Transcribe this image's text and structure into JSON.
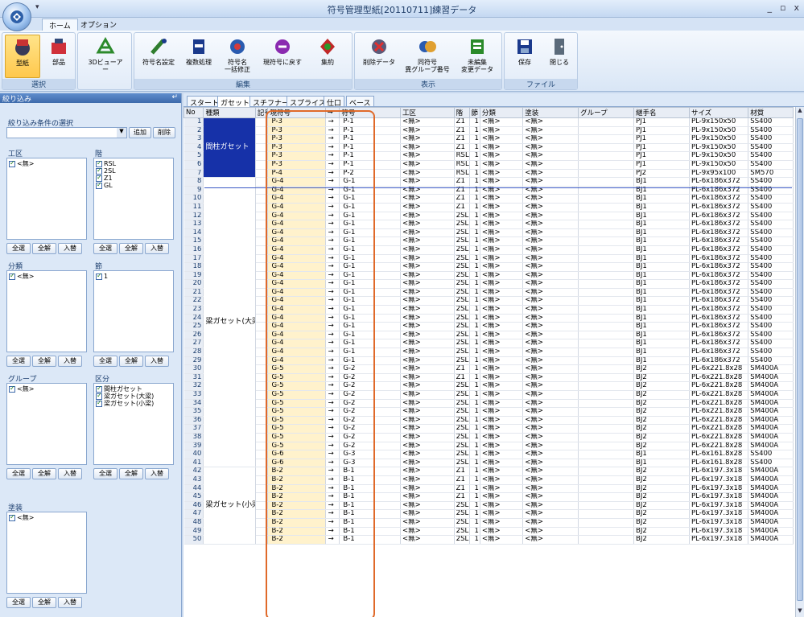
{
  "window": {
    "title": "符号管理型紙[20110711]練習データ",
    "quick_access": "▾",
    "controls": [
      "_",
      "▫",
      "x"
    ]
  },
  "ribbon_tabs": [
    "ホーム",
    "オプション"
  ],
  "ribbon": {
    "groups": [
      {
        "label": "選択",
        "buttons": [
          "型紙",
          "部品"
        ]
      },
      {
        "label": "",
        "buttons": [
          "3Dビューアー"
        ]
      },
      {
        "label": "編集",
        "buttons": [
          "符号名設定",
          "複数処理",
          "符号名\n一括修正",
          "現符号に戻す",
          "集約"
        ]
      },
      {
        "label": "表示",
        "buttons": [
          "削除データ",
          "同符号\n異グループ番号",
          "未編集\n変更データ"
        ]
      },
      {
        "label": "ファイル",
        "buttons": [
          "保存",
          "閉じる"
        ]
      }
    ]
  },
  "filter_panel": {
    "header": "絞り込み",
    "condition_label": "絞り込み条件の選択",
    "add_button": "追加",
    "delete_button": "削除",
    "sections": [
      {
        "title": "工区",
        "items": [
          "<無>"
        ]
      },
      {
        "title": "階",
        "items": [
          "RSL",
          "2SL",
          "Z1",
          "GL"
        ]
      },
      {
        "title": "分類",
        "items": [
          "<無>"
        ]
      },
      {
        "title": "節",
        "items": [
          "1"
        ]
      },
      {
        "title": "グループ",
        "items": [
          "<無>"
        ]
      },
      {
        "title": "区分",
        "items": [
          "間柱ガセット",
          "梁ガセット(大梁)",
          "梁ガセット(小梁)"
        ]
      },
      {
        "title": "塗装",
        "items": [
          "<無>"
        ]
      }
    ],
    "buttons": {
      "all_select": "全選",
      "all_clear": "全解",
      "swap": "入替"
    }
  },
  "grid_tabs": [
    "スタート",
    "ガセット",
    "スチフナー",
    "スプライス",
    "仕口",
    "ベース"
  ],
  "grid_active_tab": 1,
  "columns": [
    "No",
    "種類",
    "記号",
    "現符号",
    "→",
    "符号",
    "工区",
    "階",
    "節",
    "分類",
    "塗装",
    "グループ",
    "継手名",
    "サイズ",
    "材質"
  ],
  "groups": [
    {
      "label": "間柱ガセット",
      "start": 0,
      "span": 7,
      "highlight": true
    },
    {
      "label": "梁ガセット(大梁",
      "start": 7,
      "span": 34,
      "highlight": false
    },
    {
      "label": "梁ガセット(小梁",
      "start": 41,
      "span": 9,
      "highlight": false
    }
  ],
  "rows": [
    [
      "1",
      "P-3",
      "→",
      "P-1",
      "<無>",
      "Z1",
      "1",
      "<無>",
      "<無>",
      "",
      "PJ1",
      "PL-9x150x50",
      "SS400"
    ],
    [
      "2",
      "P-3",
      "→",
      "P-1",
      "<無>",
      "Z1",
      "1",
      "<無>",
      "<無>",
      "",
      "PJ1",
      "PL-9x150x50",
      "SS400"
    ],
    [
      "3",
      "P-3",
      "→",
      "P-1",
      "<無>",
      "Z1",
      "1",
      "<無>",
      "<無>",
      "",
      "PJ1",
      "PL-9x150x50",
      "SS400"
    ],
    [
      "4",
      "P-3",
      "→",
      "P-1",
      "<無>",
      "Z1",
      "1",
      "<無>",
      "<無>",
      "",
      "PJ1",
      "PL-9x150x50",
      "SS400"
    ],
    [
      "5",
      "P-3",
      "→",
      "P-1",
      "<無>",
      "RSL",
      "1",
      "<無>",
      "<無>",
      "",
      "PJ1",
      "PL-9x150x50",
      "SS400"
    ],
    [
      "6",
      "P-3",
      "→",
      "P-1",
      "<無>",
      "RSL",
      "1",
      "<無>",
      "<無>",
      "",
      "PJ1",
      "PL-9x150x50",
      "SS400"
    ],
    [
      "7",
      "P-4",
      "→",
      "P-2",
      "<無>",
      "RSL",
      "1",
      "<無>",
      "<無>",
      "",
      "PJ2",
      "PL-9x95x100",
      "SM570"
    ],
    [
      "8",
      "G-4",
      "→",
      "G-1",
      "<無>",
      "Z1",
      "1",
      "<無>",
      "<無>",
      "",
      "BJ1",
      "PL-6x186x372",
      "SS400"
    ],
    [
      "9",
      "G-4",
      "→",
      "G-1",
      "<無>",
      "Z1",
      "1",
      "<無>",
      "<無>",
      "",
      "BJ1",
      "PL-6x186x372",
      "SS400"
    ],
    [
      "10",
      "G-4",
      "→",
      "G-1",
      "<無>",
      "Z1",
      "1",
      "<無>",
      "<無>",
      "",
      "BJ1",
      "PL-6x186x372",
      "SS400"
    ],
    [
      "11",
      "G-4",
      "→",
      "G-1",
      "<無>",
      "Z1",
      "1",
      "<無>",
      "<無>",
      "",
      "BJ1",
      "PL-6x186x372",
      "SS400"
    ],
    [
      "12",
      "G-4",
      "→",
      "G-1",
      "<無>",
      "2SL",
      "1",
      "<無>",
      "<無>",
      "",
      "BJ1",
      "PL-6x186x372",
      "SS400"
    ],
    [
      "13",
      "G-4",
      "→",
      "G-1",
      "<無>",
      "2SL",
      "1",
      "<無>",
      "<無>",
      "",
      "BJ1",
      "PL-6x186x372",
      "SS400"
    ],
    [
      "14",
      "G-4",
      "→",
      "G-1",
      "<無>",
      "2SL",
      "1",
      "<無>",
      "<無>",
      "",
      "BJ1",
      "PL-6x186x372",
      "SS400"
    ],
    [
      "15",
      "G-4",
      "→",
      "G-1",
      "<無>",
      "2SL",
      "1",
      "<無>",
      "<無>",
      "",
      "BJ1",
      "PL-6x186x372",
      "SS400"
    ],
    [
      "16",
      "G-4",
      "→",
      "G-1",
      "<無>",
      "2SL",
      "1",
      "<無>",
      "<無>",
      "",
      "BJ1",
      "PL-6x186x372",
      "SS400"
    ],
    [
      "17",
      "G-4",
      "→",
      "G-1",
      "<無>",
      "2SL",
      "1",
      "<無>",
      "<無>",
      "",
      "BJ1",
      "PL-6x186x372",
      "SS400"
    ],
    [
      "18",
      "G-4",
      "→",
      "G-1",
      "<無>",
      "2SL",
      "1",
      "<無>",
      "<無>",
      "",
      "BJ1",
      "PL-6x186x372",
      "SS400"
    ],
    [
      "19",
      "G-4",
      "→",
      "G-1",
      "<無>",
      "2SL",
      "1",
      "<無>",
      "<無>",
      "",
      "BJ1",
      "PL-6x186x372",
      "SS400"
    ],
    [
      "20",
      "G-4",
      "→",
      "G-1",
      "<無>",
      "2SL",
      "1",
      "<無>",
      "<無>",
      "",
      "BJ1",
      "PL-6x186x372",
      "SS400"
    ],
    [
      "21",
      "G-4",
      "→",
      "G-1",
      "<無>",
      "2SL",
      "1",
      "<無>",
      "<無>",
      "",
      "BJ1",
      "PL-6x186x372",
      "SS400"
    ],
    [
      "22",
      "G-4",
      "→",
      "G-1",
      "<無>",
      "2SL",
      "1",
      "<無>",
      "<無>",
      "",
      "BJ1",
      "PL-6x186x372",
      "SS400"
    ],
    [
      "23",
      "G-4",
      "→",
      "G-1",
      "<無>",
      "2SL",
      "1",
      "<無>",
      "<無>",
      "",
      "BJ1",
      "PL-6x186x372",
      "SS400"
    ],
    [
      "24",
      "G-4",
      "→",
      "G-1",
      "<無>",
      "2SL",
      "1",
      "<無>",
      "<無>",
      "",
      "BJ1",
      "PL-6x186x372",
      "SS400"
    ],
    [
      "25",
      "G-4",
      "→",
      "G-1",
      "<無>",
      "2SL",
      "1",
      "<無>",
      "<無>",
      "",
      "BJ1",
      "PL-6x186x372",
      "SS400"
    ],
    [
      "26",
      "G-4",
      "→",
      "G-1",
      "<無>",
      "2SL",
      "1",
      "<無>",
      "<無>",
      "",
      "BJ1",
      "PL-6x186x372",
      "SS400"
    ],
    [
      "27",
      "G-4",
      "→",
      "G-1",
      "<無>",
      "2SL",
      "1",
      "<無>",
      "<無>",
      "",
      "BJ1",
      "PL-6x186x372",
      "SS400"
    ],
    [
      "28",
      "G-4",
      "→",
      "G-1",
      "<無>",
      "2SL",
      "1",
      "<無>",
      "<無>",
      "",
      "BJ1",
      "PL-6x186x372",
      "SS400"
    ],
    [
      "29",
      "G-4",
      "→",
      "G-1",
      "<無>",
      "2SL",
      "1",
      "<無>",
      "<無>",
      "",
      "BJ1",
      "PL-6x186x372",
      "SS400"
    ],
    [
      "30",
      "G-5",
      "→",
      "G-2",
      "<無>",
      "Z1",
      "1",
      "<無>",
      "<無>",
      "",
      "BJ2",
      "PL-6x221.8x28",
      "SM400A"
    ],
    [
      "31",
      "G-5",
      "→",
      "G-2",
      "<無>",
      "Z1",
      "1",
      "<無>",
      "<無>",
      "",
      "BJ2",
      "PL-6x221.8x28",
      "SM400A"
    ],
    [
      "32",
      "G-5",
      "→",
      "G-2",
      "<無>",
      "2SL",
      "1",
      "<無>",
      "<無>",
      "",
      "BJ2",
      "PL-6x221.8x28",
      "SM400A"
    ],
    [
      "33",
      "G-5",
      "→",
      "G-2",
      "<無>",
      "2SL",
      "1",
      "<無>",
      "<無>",
      "",
      "BJ2",
      "PL-6x221.8x28",
      "SM400A"
    ],
    [
      "34",
      "G-5",
      "→",
      "G-2",
      "<無>",
      "2SL",
      "1",
      "<無>",
      "<無>",
      "",
      "BJ2",
      "PL-6x221.8x28",
      "SM400A"
    ],
    [
      "35",
      "G-5",
      "→",
      "G-2",
      "<無>",
      "2SL",
      "1",
      "<無>",
      "<無>",
      "",
      "BJ2",
      "PL-6x221.8x28",
      "SM400A"
    ],
    [
      "36",
      "G-5",
      "→",
      "G-2",
      "<無>",
      "2SL",
      "1",
      "<無>",
      "<無>",
      "",
      "BJ2",
      "PL-6x221.8x28",
      "SM400A"
    ],
    [
      "37",
      "G-5",
      "→",
      "G-2",
      "<無>",
      "2SL",
      "1",
      "<無>",
      "<無>",
      "",
      "BJ2",
      "PL-6x221.8x28",
      "SM400A"
    ],
    [
      "38",
      "G-5",
      "→",
      "G-2",
      "<無>",
      "2SL",
      "1",
      "<無>",
      "<無>",
      "",
      "BJ2",
      "PL-6x221.8x28",
      "SM400A"
    ],
    [
      "39",
      "G-5",
      "→",
      "G-2",
      "<無>",
      "2SL",
      "1",
      "<無>",
      "<無>",
      "",
      "BJ2",
      "PL-6x221.8x28",
      "SM400A"
    ],
    [
      "40",
      "G-6",
      "→",
      "G-3",
      "<無>",
      "2SL",
      "1",
      "<無>",
      "<無>",
      "",
      "BJ1",
      "PL-6x161.8x28",
      "SS400"
    ],
    [
      "41",
      "G-6",
      "→",
      "G-3",
      "<無>",
      "2SL",
      "1",
      "<無>",
      "<無>",
      "",
      "BJ1",
      "PL-6x161.8x28",
      "SS400"
    ],
    [
      "42",
      "B-2",
      "→",
      "B-1",
      "<無>",
      "Z1",
      "1",
      "<無>",
      "<無>",
      "",
      "BJ2",
      "PL-6x197.3x18",
      "SM400A"
    ],
    [
      "43",
      "B-2",
      "→",
      "B-1",
      "<無>",
      "Z1",
      "1",
      "<無>",
      "<無>",
      "",
      "BJ2",
      "PL-6x197.3x18",
      "SM400A"
    ],
    [
      "44",
      "B-2",
      "→",
      "B-1",
      "<無>",
      "Z1",
      "1",
      "<無>",
      "<無>",
      "",
      "BJ2",
      "PL-6x197.3x18",
      "SM400A"
    ],
    [
      "45",
      "B-2",
      "→",
      "B-1",
      "<無>",
      "Z1",
      "1",
      "<無>",
      "<無>",
      "",
      "BJ2",
      "PL-6x197.3x18",
      "SM400A"
    ],
    [
      "46",
      "B-2",
      "→",
      "B-1",
      "<無>",
      "2SL",
      "1",
      "<無>",
      "<無>",
      "",
      "BJ2",
      "PL-6x197.3x18",
      "SM400A"
    ],
    [
      "47",
      "B-2",
      "→",
      "B-1",
      "<無>",
      "2SL",
      "1",
      "<無>",
      "<無>",
      "",
      "BJ2",
      "PL-6x197.3x18",
      "SM400A"
    ],
    [
      "48",
      "B-2",
      "→",
      "B-1",
      "<無>",
      "2SL",
      "1",
      "<無>",
      "<無>",
      "",
      "BJ2",
      "PL-6x197.3x18",
      "SM400A"
    ],
    [
      "49",
      "B-2",
      "→",
      "B-1",
      "<無>",
      "2SL",
      "1",
      "<無>",
      "<無>",
      "",
      "BJ2",
      "PL-6x197.3x18",
      "SM400A"
    ],
    [
      "50",
      "B-2",
      "→",
      "B-1",
      "<無>",
      "2SL",
      "1",
      "<無>",
      "<無>",
      "",
      "BJ2",
      "PL-6x197.3x18",
      "SM400A"
    ]
  ],
  "colors": {
    "highlight_group": "#1631a8",
    "orig_column": "#fff2cc",
    "annotation_box": "#e06a2a"
  }
}
